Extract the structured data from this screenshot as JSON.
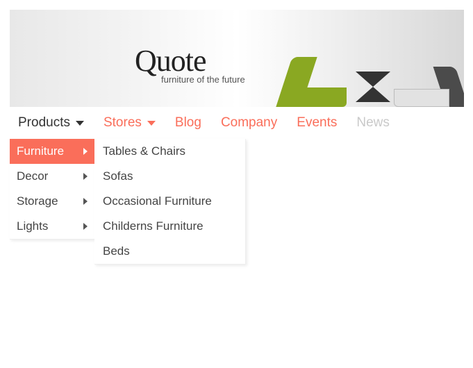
{
  "brand": {
    "name": "Quote",
    "tagline": "furniture of the future"
  },
  "nav": {
    "products": "Products",
    "stores": "Stores",
    "blog": "Blog",
    "company": "Company",
    "events": "Events",
    "news": "News"
  },
  "submenu1": {
    "furniture": "Furniture",
    "decor": "Decor",
    "storage": "Storage",
    "lights": "Lights"
  },
  "submenu2": {
    "tables_chairs": "Tables & Chairs",
    "sofas": "Sofas",
    "occasional": "Occasional Furniture",
    "childerns": "Childerns Furniture",
    "beds": "Beds"
  }
}
